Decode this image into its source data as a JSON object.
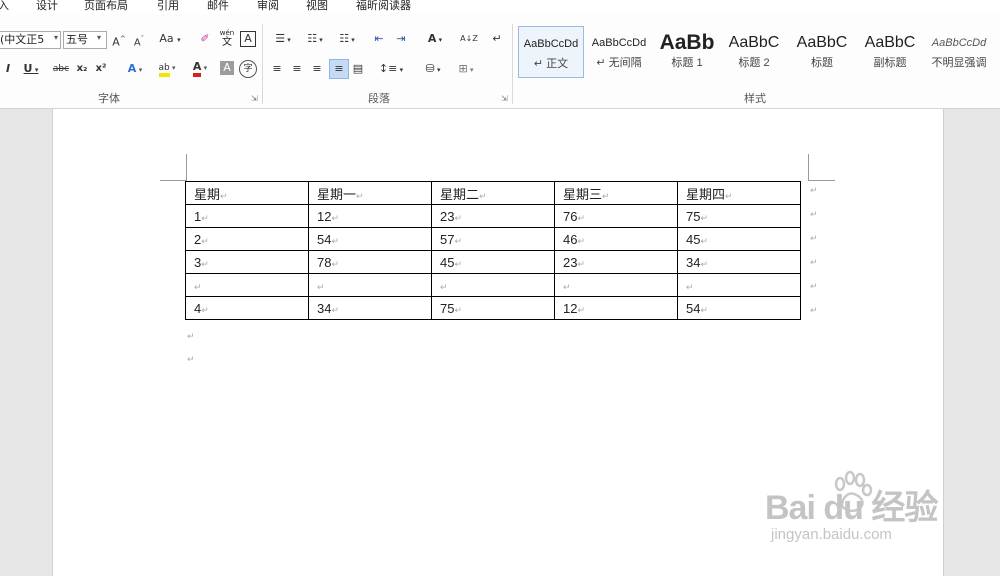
{
  "menu": {
    "tabs": [
      "入",
      "设计",
      "页面布局",
      "引用",
      "邮件",
      "审阅",
      "视图",
      "福昕阅读器"
    ]
  },
  "ribbon": {
    "font_group": {
      "label": "字体",
      "font_name": "(中文正5",
      "font_size": "五号",
      "grow_font": "A",
      "shrink_font": "A",
      "change_case": "Aa",
      "pinyin_top": "wén",
      "pinyin_char": "文",
      "char_border": "A",
      "italic": "I",
      "underline": "U",
      "strikethrough": "abc",
      "subscript": "x₂",
      "superscript": "x²",
      "text_effect": "A",
      "highlight": "ab",
      "font_color": "A",
      "char_shading": "A",
      "enclose_char": "字"
    },
    "paragraph_group": {
      "label": "段落",
      "bullets": "☰",
      "numbering": "☷",
      "multilevel": "☷",
      "decrease_indent": "⇤",
      "increase_indent": "⇥",
      "chinese_layout": "A",
      "sort": "A↓Z",
      "show_marks": "↵"
    },
    "styles_group": {
      "label": "样式",
      "items": [
        {
          "sample": "AaBbCcDd",
          "name": "↵ 正文"
        },
        {
          "sample": "AaBbCcDd",
          "name": "↵ 无间隔"
        },
        {
          "sample": "AaBb",
          "name": "标题 1"
        },
        {
          "sample": "AaBbC",
          "name": "标题 2"
        },
        {
          "sample": "AaBbC",
          "name": "标题"
        },
        {
          "sample": "AaBbC",
          "name": "副标题"
        },
        {
          "sample": "AaBbCcDd",
          "name": "不明显强调"
        }
      ]
    }
  },
  "document": {
    "table": {
      "header": [
        "星期",
        "星期一",
        "星期二",
        "星期三",
        "星期四"
      ],
      "rows": [
        [
          "1",
          "12",
          "23",
          "76",
          "75"
        ],
        [
          "2",
          "54",
          "57",
          "46",
          "45"
        ],
        [
          "3",
          "78",
          "45",
          "23",
          "34"
        ],
        [
          "",
          "",
          "",
          "",
          ""
        ],
        [
          "4",
          "34",
          "75",
          "12",
          "54"
        ]
      ]
    },
    "paragraph_mark": "↵"
  },
  "watermark": {
    "brand": "Bai du 经验",
    "url": "jingyan.baidu.com"
  }
}
